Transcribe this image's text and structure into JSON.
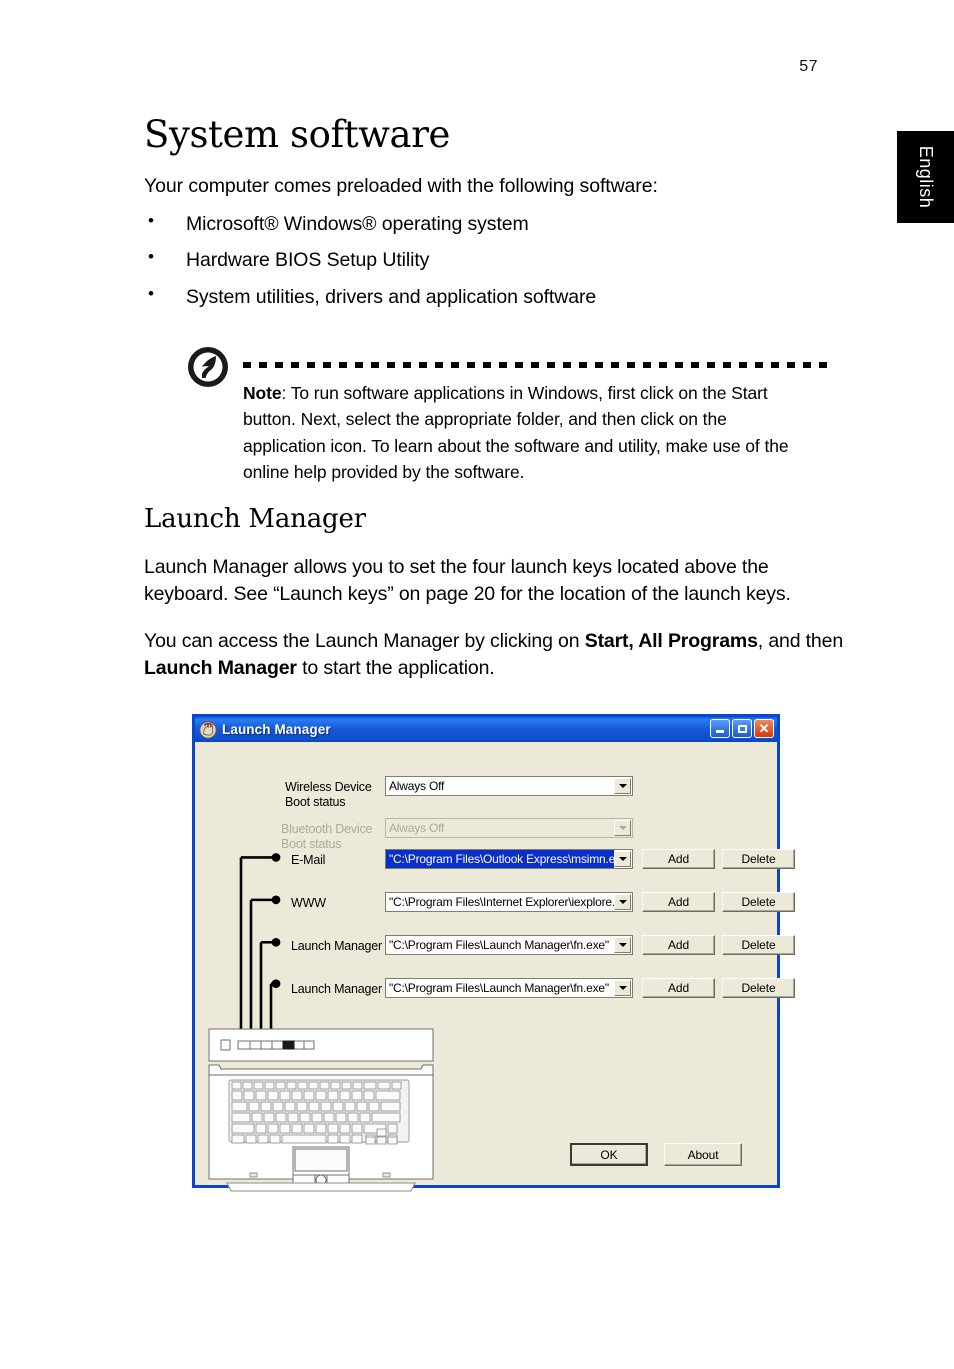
{
  "page": {
    "number": "57",
    "language_tab": "English"
  },
  "document": {
    "title": "System software",
    "lead": "Your computer comes preloaded with the following software:",
    "bullets": [
      "Microsoft® Windows® operating system",
      "Hardware BIOS Setup Utility",
      "System utilities, drivers and application software"
    ],
    "note": {
      "label": "Note",
      "body": ": To run software applications in Windows, first click on the Start button. Next, select the appropriate folder, and then click on the application icon. To learn about the software and utility, make use of the online help provided by the software."
    },
    "section_title": "Launch Manager",
    "paragraph_1": "Launch Manager allows you to set the four launch keys located above the keyboard. See “Launch keys” on page 20 for the location of the launch keys.",
    "paragraph_2": {
      "part1": "You can access the Launch Manager by clicking on ",
      "bold1": "Start, All Programs",
      "part2": ", and then ",
      "bold2": "Launch Manager",
      "part3": " to start the application."
    }
  },
  "dialog": {
    "title": "Launch Manager",
    "window_buttons": {
      "minimize": "–",
      "maximize": "□",
      "close": "✕"
    },
    "device_rows": [
      {
        "label_line1": "Wireless Device",
        "label_line2": "Boot status",
        "value": "Always Off",
        "disabled": false
      },
      {
        "label_line1": "Bluetooth Device",
        "label_line2": "Boot status",
        "value": "Always Off",
        "disabled": true
      }
    ],
    "key_rows": [
      {
        "label": "E-Mail",
        "value": "\"C:\\Program Files\\Outlook Express\\msimn.ex",
        "selected": true,
        "add": "Add",
        "delete": "Delete"
      },
      {
        "label": "WWW",
        "value": "\"C:\\Program Files\\Internet Explorer\\iexplore.e",
        "selected": false,
        "add": "Add",
        "delete": "Delete"
      },
      {
        "label": "Launch Manager",
        "value": "\"C:\\Program Files\\Launch Manager\\fn.exe\"",
        "selected": false,
        "add": "Add",
        "delete": "Delete"
      },
      {
        "label": "Launch Manager",
        "value": "\"C:\\Program Files\\Launch Manager\\fn.exe\"",
        "selected": false,
        "add": "Add",
        "delete": "Delete"
      }
    ],
    "footer_buttons": {
      "ok": "OK",
      "about": "About"
    },
    "colors": {
      "titlebar": "#1457d8",
      "face": "#ece9d8",
      "frame": "#0a48c8",
      "selection": "#0a2ec8",
      "close": "#d4370c"
    }
  }
}
